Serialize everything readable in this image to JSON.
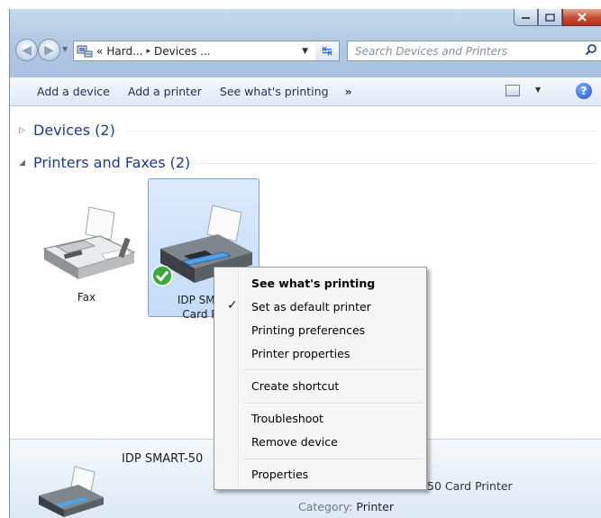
{
  "window": {
    "caption_buttons": {
      "minimize": "minimize-icon",
      "maximize": "maximize-icon",
      "close": "close-icon"
    }
  },
  "navigation": {
    "back_icon": "back-arrow-icon",
    "forward_icon": "forward-arrow-icon",
    "address": {
      "overflow": "«",
      "crumbs": [
        "Hard...",
        "Devices ..."
      ],
      "separator": "▸"
    },
    "refresh_icon": "refresh-icon",
    "search_placeholder": "Search Devices and Printers"
  },
  "command_bar": {
    "items": [
      "Add a device",
      "Add a printer",
      "See what's printing"
    ],
    "more": "»",
    "help": "?"
  },
  "groups": [
    {
      "label": "Devices (2)",
      "expanded": false
    },
    {
      "label": "Printers and Faxes (2)",
      "expanded": true
    }
  ],
  "devices": [
    {
      "name": "Fax",
      "icon": "fax-icon",
      "selected": false
    },
    {
      "name_line1": "IDP SMAR",
      "name_line2": "Card Pri",
      "icon": "printer-icon",
      "selected": true,
      "default_badge": "default-check-icon"
    }
  ],
  "details_pane": {
    "title": "IDP SMART-50",
    "model_fragment": "50 Card Printer",
    "category_label": "Category:",
    "category_value": "Printer"
  },
  "context_menu": {
    "items": [
      {
        "label": "See what's printing",
        "bold": true
      },
      {
        "label": "Set as default printer",
        "checked": true
      },
      {
        "label": "Printing preferences"
      },
      {
        "label": "Printer properties"
      },
      {
        "label": "Create shortcut"
      },
      {
        "label": "Troubleshoot"
      },
      {
        "label": "Remove device"
      },
      {
        "label": "Properties"
      }
    ],
    "check_glyph": "✓"
  },
  "colors": {
    "title_gradient": "#b3c9e4",
    "close_red": "#c94a30",
    "group_blue": "#1e3a8a",
    "selection": "#c4dcf8"
  }
}
